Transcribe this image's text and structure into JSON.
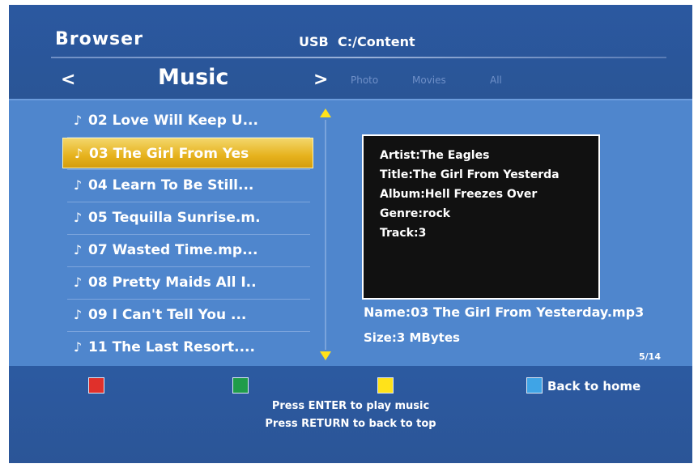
{
  "header": {
    "app_title": "Browser",
    "source_label": "USB",
    "source_path": "C:/Content",
    "nav_prev": "<",
    "nav_next": ">",
    "current_category": "Music",
    "other_categories": [
      "Photo",
      "Movies",
      "All"
    ]
  },
  "file_list": {
    "note_icon": "music-note-icon",
    "selected_index": 1,
    "items": [
      "02 Love Will Keep U...",
      "03 The Girl From Yes",
      "04 Learn To Be Still...",
      "05 Tequilla Sunrise.m.",
      "07 Wasted Time.mp...",
      "08 Pretty Maids All I..",
      "09 I Can't Tell You ...",
      "11 The Last Resort...."
    ]
  },
  "info": {
    "artist": "Artist:The Eagles",
    "title": "Title:The Girl From Yesterda",
    "album": "Album:Hell Freezes Over",
    "genre": "Genre:rock",
    "track": "Track:3"
  },
  "file_name": "Name:03 The Girl From Yesterday.mp3",
  "file_size": "Size:3 MBytes",
  "page_counter": "5/14",
  "footer": {
    "back_home": "Back to home",
    "hint_enter": "Press ENTER to play music",
    "hint_return": "Press RETURN to back to top"
  },
  "colors": {
    "background": "#2f5ba1",
    "content_panel": "#4f86cd",
    "selected_row": "#e6b21d",
    "key_red": "#e0302b",
    "key_green": "#1f9c4a",
    "key_yellow": "#ffe21a",
    "key_blue": "#3fa4e6"
  }
}
